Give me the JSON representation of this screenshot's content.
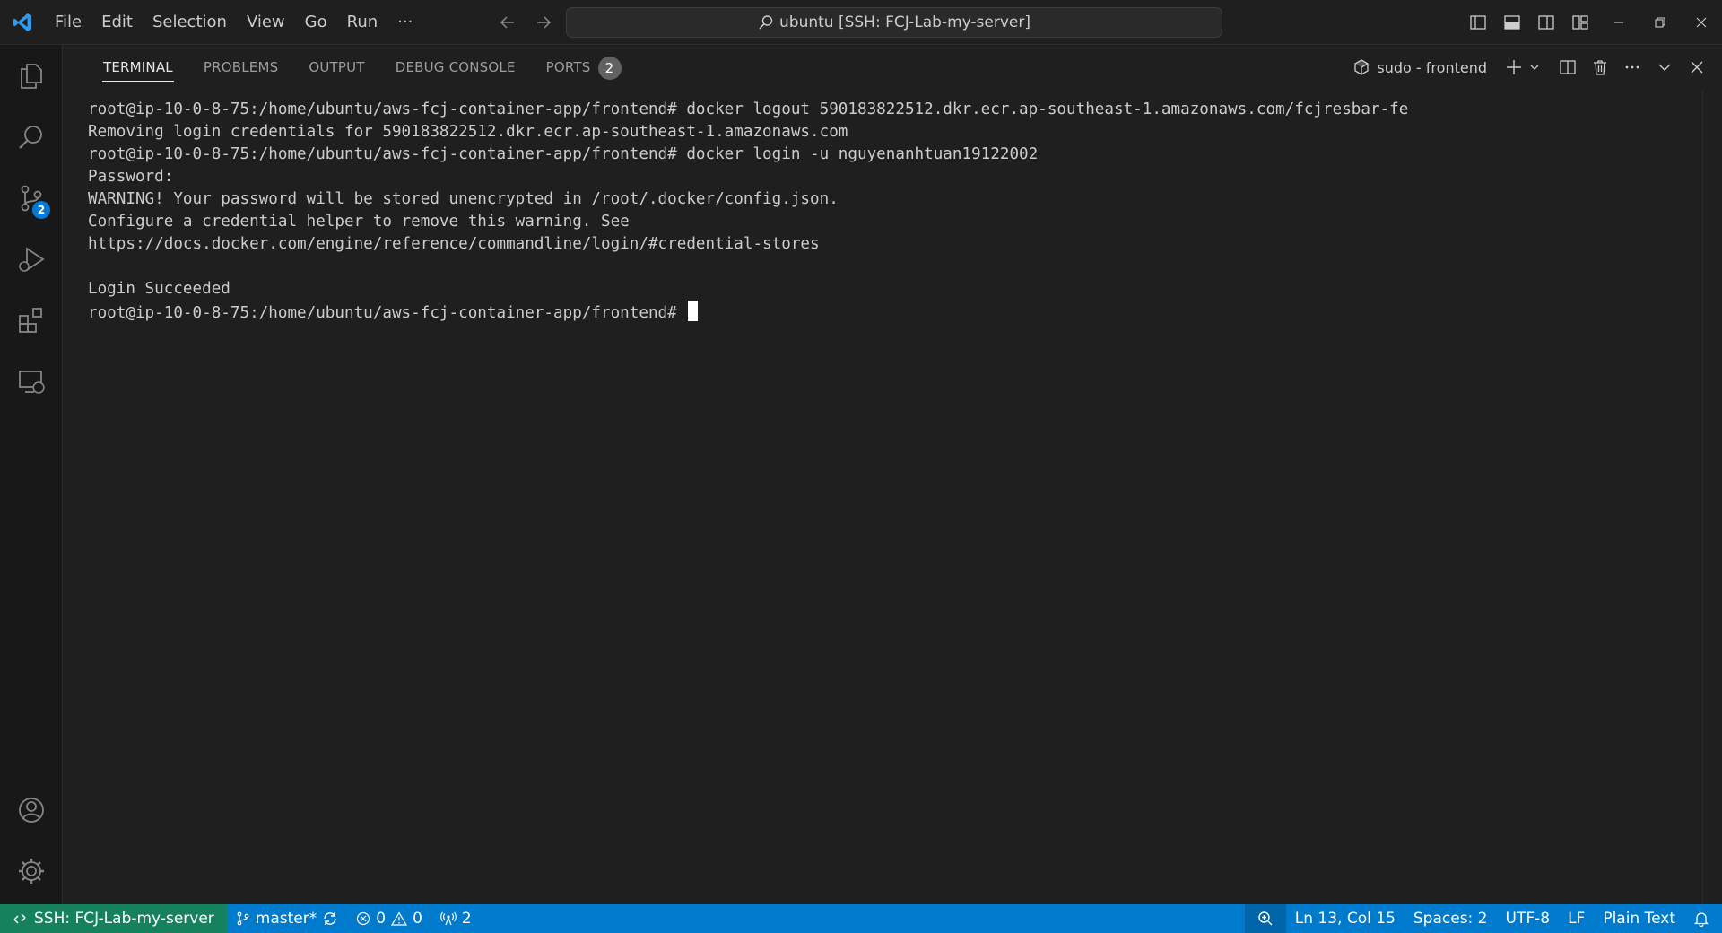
{
  "window": {
    "menu": [
      "File",
      "Edit",
      "Selection",
      "View",
      "Go",
      "Run"
    ],
    "more_menu": "···",
    "command_center": "ubuntu [SSH: FCJ-Lab-my-server]"
  },
  "activity_bar": {
    "items": [
      "explorer",
      "search",
      "source-control",
      "run-and-debug",
      "extensions",
      "remote-explorer"
    ],
    "source_control_badge": "2",
    "bottom_items": [
      "accounts",
      "manage"
    ]
  },
  "panel": {
    "tabs": [
      {
        "label": "TERMINAL",
        "active": true
      },
      {
        "label": "PROBLEMS",
        "active": false
      },
      {
        "label": "OUTPUT",
        "active": false
      },
      {
        "label": "DEBUG CONSOLE",
        "active": false
      },
      {
        "label": "PORTS",
        "active": false
      }
    ],
    "ports_count": "2",
    "terminal_name": "sudo - frontend"
  },
  "terminal": {
    "lines": [
      "root@ip-10-0-8-75:/home/ubuntu/aws-fcj-container-app/frontend# docker logout 590183822512.dkr.ecr.ap-southeast-1.amazonaws.com/fcjresbar-fe",
      "Removing login credentials for 590183822512.dkr.ecr.ap-southeast-1.amazonaws.com",
      "root@ip-10-0-8-75:/home/ubuntu/aws-fcj-container-app/frontend# docker login -u nguyenanhtuan19122002",
      "Password:",
      "WARNING! Your password will be stored unencrypted in /root/.docker/config.json.",
      "Configure a credential helper to remove this warning. See",
      "https://docs.docker.com/engine/reference/commandline/login/#credential-stores",
      "",
      "Login Succeeded"
    ],
    "prompt": "root@ip-10-0-8-75:/home/ubuntu/aws-fcj-container-app/frontend# "
  },
  "status_bar": {
    "remote": "SSH: FCJ-Lab-my-server",
    "branch": "master*",
    "errors": "0",
    "warnings": "0",
    "ports": "2",
    "cursor_position": "Ln 13, Col 15",
    "indentation": "Spaces: 2",
    "encoding": "UTF-8",
    "eol": "LF",
    "language": "Plain Text"
  },
  "colors": {
    "status_bar": "#007acc",
    "remote_indicator": "#16825d",
    "accent": "#0078d4"
  }
}
